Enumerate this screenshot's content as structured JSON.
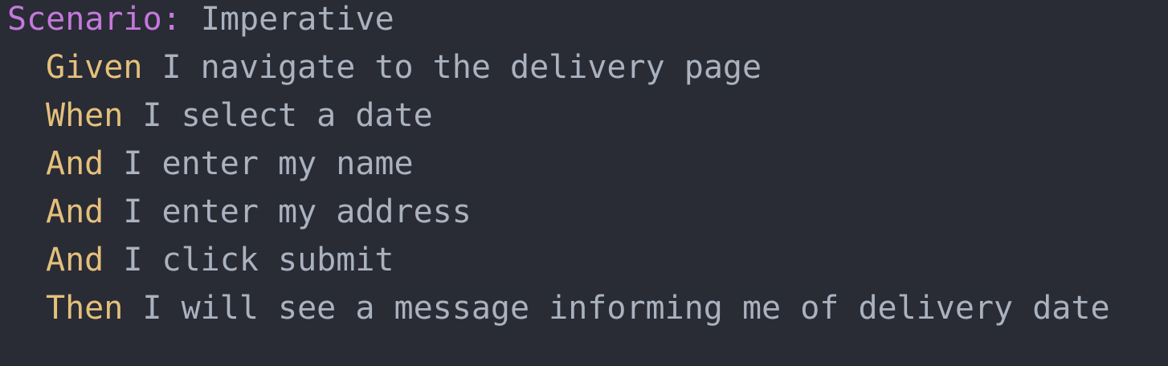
{
  "scenario": {
    "keyword": "Scenario:",
    "title": "Imperative"
  },
  "steps": [
    {
      "keyword": "Given",
      "text": "I navigate to the delivery page"
    },
    {
      "keyword": "When",
      "text": "I select a date"
    },
    {
      "keyword": "And",
      "text": "I enter my name"
    },
    {
      "keyword": "And",
      "text": "I enter my address"
    },
    {
      "keyword": "And",
      "text": "I click submit"
    },
    {
      "keyword": "Then",
      "text": "I will see a message informing me of delivery date"
    }
  ],
  "colors": {
    "background": "#292c35",
    "scenario_keyword": "#c678dd",
    "step_keyword": "#e5c07b",
    "text": "#abb2bf"
  }
}
